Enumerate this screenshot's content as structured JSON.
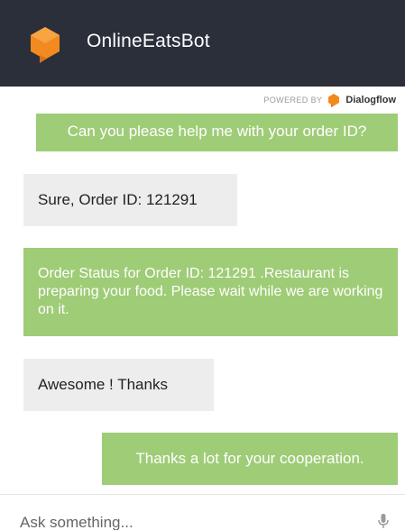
{
  "header": {
    "bot_name": "OnlineEatsBot",
    "accent_color": "#f28a1f",
    "background": "#2b2f3a",
    "logo_icon": "chat-bubble-hexagon-icon"
  },
  "powered_by": {
    "label": "POWERED BY",
    "brand": "Dialogflow",
    "brand_icon": "dialogflow-icon"
  },
  "messages": [
    {
      "sender": "bot",
      "text": "Can you please help me with your order ID?"
    },
    {
      "sender": "user",
      "text": "Sure, Order ID: 121291"
    },
    {
      "sender": "bot",
      "text": "Order Status for Order ID: 121291 .Restaurant is preparing your food. Please wait while we are working on it."
    },
    {
      "sender": "user",
      "text": "Awesome ! Thanks"
    },
    {
      "sender": "bot",
      "text": "Thanks a lot for your cooperation."
    }
  ],
  "colors": {
    "bot_bubble": "#9fcc77",
    "user_bubble": "#ededed"
  },
  "input": {
    "placeholder": "Ask something...",
    "value": "",
    "mic_icon": "microphone-icon"
  }
}
